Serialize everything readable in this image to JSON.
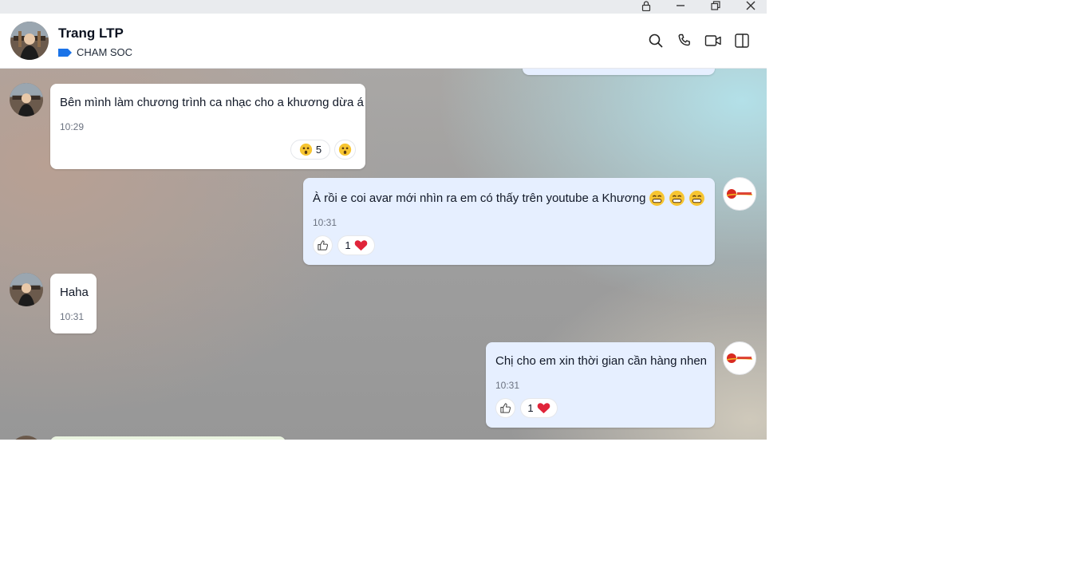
{
  "contact": {
    "name": "Trang LTP",
    "tag": "CHAM SOC"
  },
  "colors": {
    "tag_blue": "#1a73e8",
    "my_bubble": "#e6efff",
    "heart": "#e0243a"
  },
  "messages": [
    {
      "sender": "them",
      "text": "Bên mình làm chương trình ca nhạc cho a khương dừa á",
      "time": "10:29",
      "reaction_count": "5"
    },
    {
      "sender": "me",
      "text": "À rồi e coi avar mới nhìn ra em có thấy trên youtube a Khương",
      "time": "10:31",
      "reaction_count": "1"
    },
    {
      "sender": "them",
      "text": "Haha",
      "time": "10:31"
    },
    {
      "sender": "me",
      "text": "Chị cho em xin thời gian cần hàng nhen",
      "time": "10:31",
      "reaction_count": "1"
    }
  ]
}
